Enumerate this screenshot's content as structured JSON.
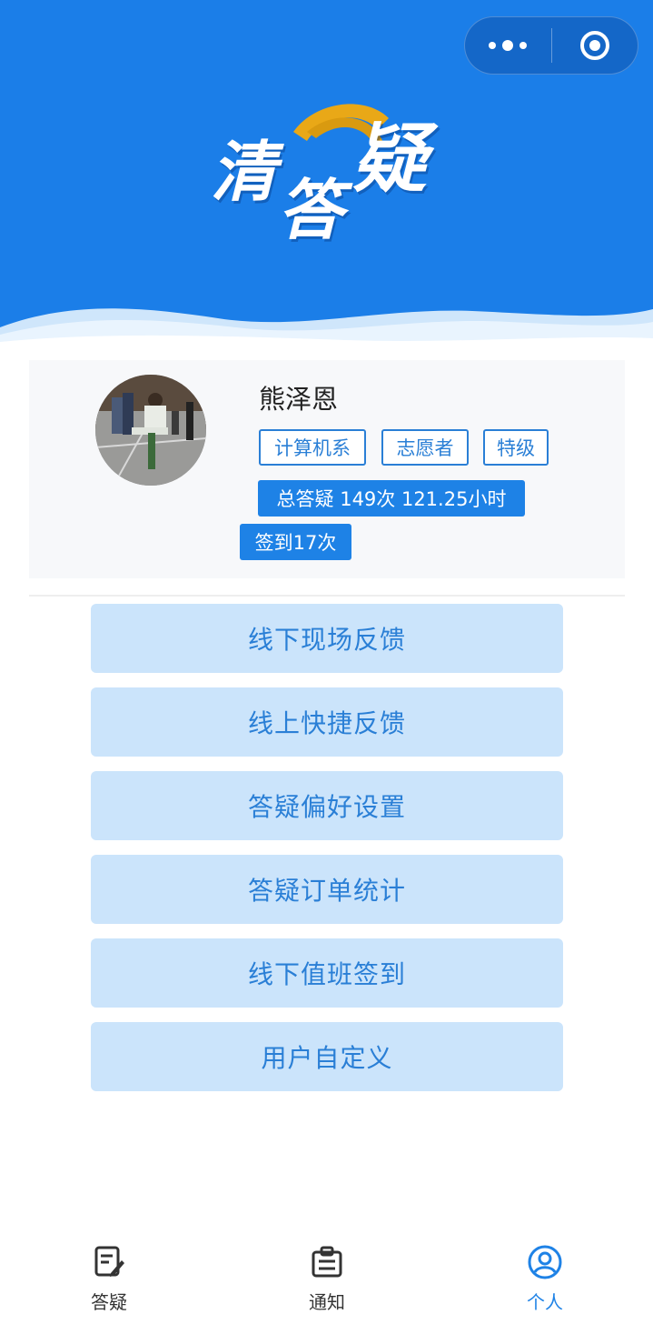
{
  "header": {
    "logo_text": "清答疑",
    "more_icon": "more-dots-icon",
    "close_icon": "target-circle-icon"
  },
  "profile": {
    "name": "熊泽恩",
    "tags": [
      "计算机系",
      "志愿者",
      "特级"
    ],
    "stats": "总答疑 149次 121.25小时",
    "checkin": "签到17次"
  },
  "menu": [
    "线下现场反馈",
    "线上快捷反馈",
    "答疑偏好设置",
    "答疑订单统计",
    "线下值班签到",
    "用户自定义"
  ],
  "tabbar": {
    "tabs": [
      {
        "label": "答疑",
        "icon": "edit-note-icon",
        "active": false
      },
      {
        "label": "通知",
        "icon": "clipboard-icon",
        "active": false
      },
      {
        "label": "个人",
        "icon": "user-circle-icon",
        "active": true
      }
    ]
  },
  "colors": {
    "header_blue": "#1b7ee8",
    "accent": "#1e82e6",
    "button_bg": "#cbe4fb",
    "logo_sun": "#e9a817"
  }
}
